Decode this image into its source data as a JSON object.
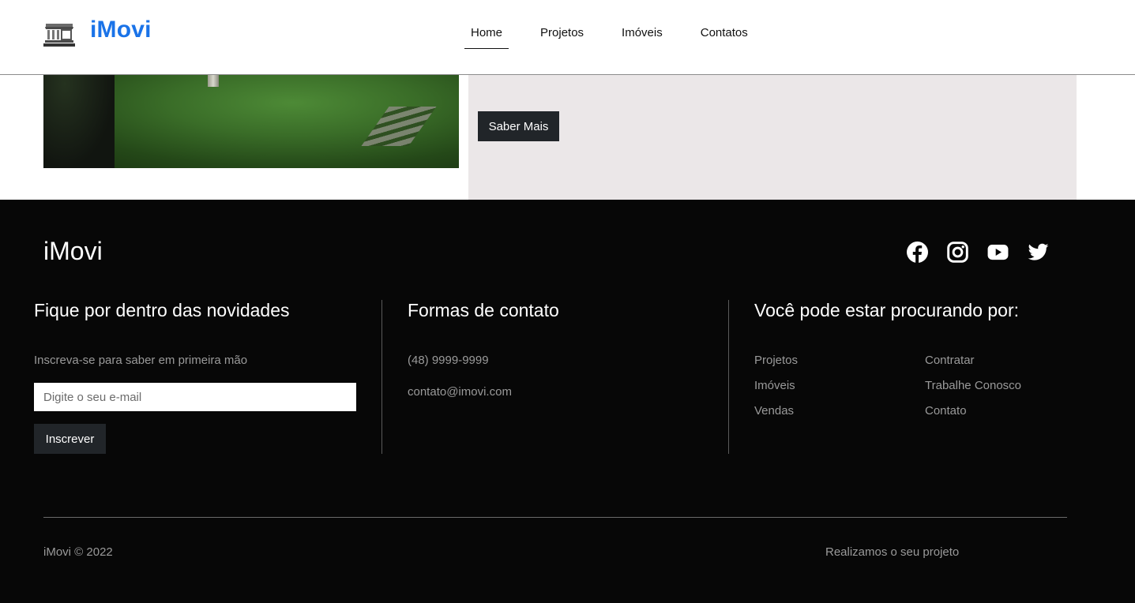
{
  "header": {
    "brand": "iMovi",
    "nav": [
      {
        "label": "Home",
        "active": true
      },
      {
        "label": "Projetos",
        "active": false
      },
      {
        "label": "Imóveis",
        "active": false
      },
      {
        "label": "Contatos",
        "active": false
      }
    ]
  },
  "hero": {
    "button_label": "Saber Mais"
  },
  "footer": {
    "brand": "iMovi",
    "socials": [
      "facebook-icon",
      "instagram-icon",
      "youtube-icon",
      "twitter-icon"
    ],
    "newsletter": {
      "title": "Fique por dentro das novidades",
      "subtitle": "Inscreva-se para saber em primeira mão",
      "email_placeholder": "Digite o seu e-mail",
      "button_label": "Inscrever"
    },
    "contact": {
      "title": "Formas de contato",
      "phone": "(48) 9999-9999",
      "email": "contato@imovi.com"
    },
    "links": {
      "title": "Você pode estar procurando por:",
      "left": [
        "Projetos",
        "Imóveis",
        "Vendas"
      ],
      "right": [
        "Contratar",
        "Trabalhe Conosco",
        "Contato"
      ]
    },
    "copyright": "iMovi © 2022",
    "tagline": "Realizamos o seu projeto"
  },
  "colors": {
    "brand_blue": "#1a73e8",
    "button_dark": "#212529",
    "footer_bg": "#070707",
    "panel_bg": "#ebe7e8"
  }
}
